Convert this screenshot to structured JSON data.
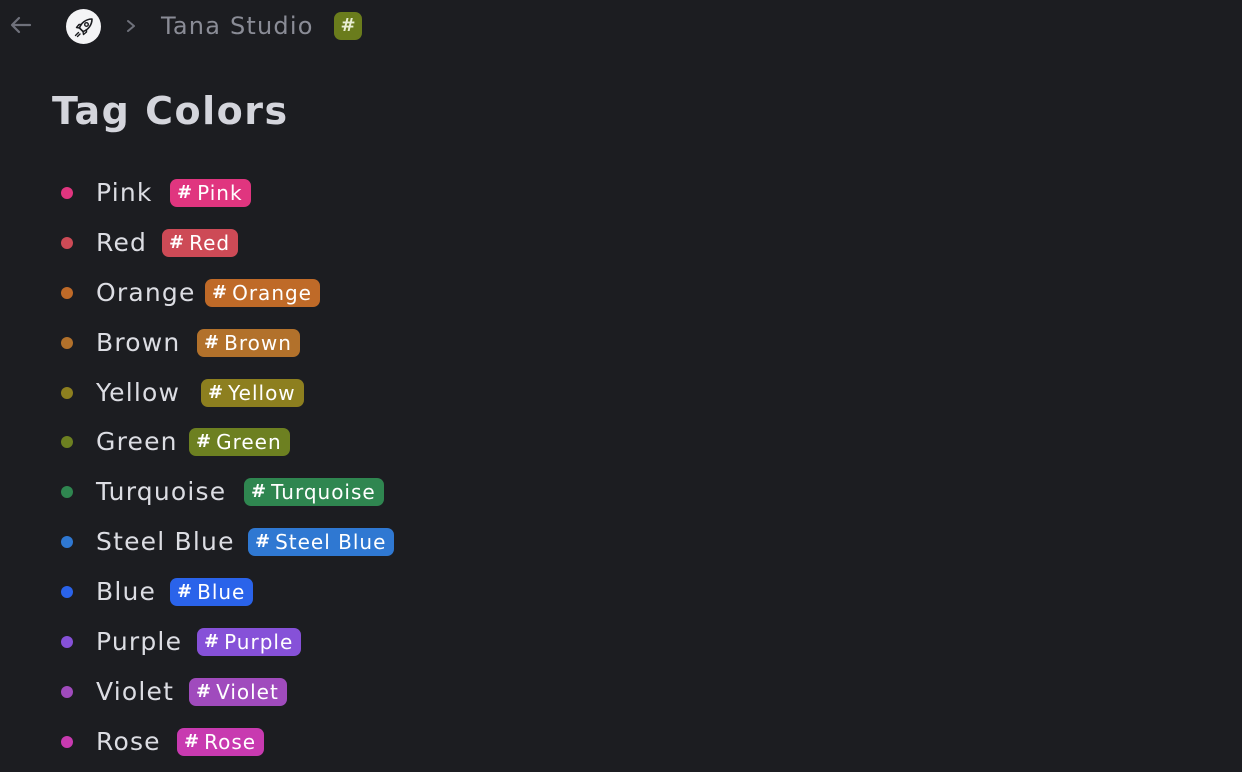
{
  "breadcrumb": {
    "back_icon": "arrow-left-icon",
    "avatar_icon": "rocket-icon",
    "separator_icon": "chevron-right-icon",
    "title": "Tana Studio",
    "tag_symbol": "#",
    "tag_color": "#6a7c1c"
  },
  "page": {
    "title": "Tag Colors"
  },
  "items": [
    {
      "label": "Pink",
      "tag_hash": "#",
      "tag_label": "Pink",
      "color": "#e0357f",
      "bullet": "#e0357f"
    },
    {
      "label": "Red",
      "tag_hash": "#",
      "tag_label": "Red",
      "color": "#cd4a56",
      "bullet": "#cd4a56"
    },
    {
      "label": "Orange",
      "tag_hash": "#",
      "tag_label": "Orange",
      "color": "#bf6a28",
      "bullet": "#bf6a28"
    },
    {
      "label": "Brown",
      "tag_hash": "#",
      "tag_label": "Brown",
      "color": "#b2712b",
      "bullet": "#b2712b"
    },
    {
      "label": "Yellow",
      "tag_hash": "#",
      "tag_label": "Yellow",
      "color": "#8d7f1f",
      "bullet": "#8d7f1f"
    },
    {
      "label": "Green",
      "tag_hash": "#",
      "tag_label": "Green",
      "color": "#6d8021",
      "bullet": "#6d8021"
    },
    {
      "label": "Turquoise",
      "tag_hash": "#",
      "tag_label": "Turquoise",
      "color": "#2f8650",
      "bullet": "#2f8650"
    },
    {
      "label": "Steel Blue",
      "tag_hash": "#",
      "tag_label": "Steel Blue",
      "color": "#2f78d2",
      "bullet": "#2f78d2"
    },
    {
      "label": "Blue",
      "tag_hash": "#",
      "tag_label": "Blue",
      "color": "#2a63ea",
      "bullet": "#2a63ea"
    },
    {
      "label": "Purple",
      "tag_hash": "#",
      "tag_label": "Purple",
      "color": "#8651d8",
      "bullet": "#8651d8"
    },
    {
      "label": "Violet",
      "tag_hash": "#",
      "tag_label": "Violet",
      "color": "#a04bbd",
      "bullet": "#a04bbd"
    },
    {
      "label": "Rose",
      "tag_hash": "#",
      "tag_label": "Rose",
      "color": "#c83ab0",
      "bullet": "#c83ab0"
    }
  ]
}
